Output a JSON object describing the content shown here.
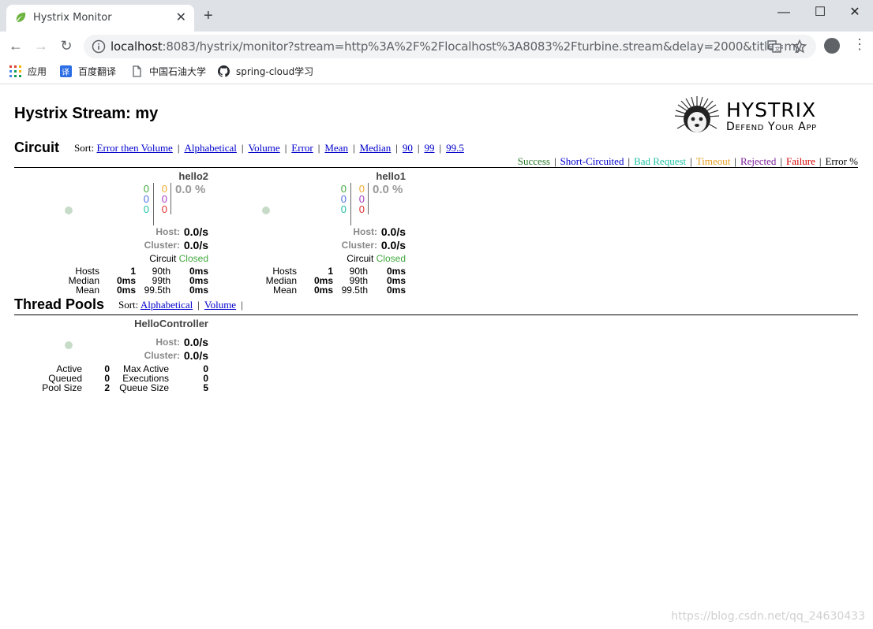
{
  "browser": {
    "tab_title": "Hystrix Monitor",
    "url_host": "localhost",
    "url_rest": ":8083/hystrix/monitor?stream=http%3A%2F%2Flocalhost%3A8083%2Fturbine.stream&delay=2000&title=my",
    "bookmarks": [
      {
        "label": "应用",
        "icon": "apps-grid-icon"
      },
      {
        "label": "百度翻译",
        "icon": "translate-icon"
      },
      {
        "label": "中国石油大学",
        "icon": "page-icon"
      },
      {
        "label": "spring-cloud学习",
        "icon": "github-icon"
      }
    ]
  },
  "page": {
    "title": "Hystrix Stream: my",
    "logo": {
      "line1": "Hystrix",
      "line2": "Defend Your App"
    },
    "circuit": {
      "heading": "Circuit",
      "sort_label": "Sort:",
      "sort_options": [
        "Error then Volume",
        "Alphabetical",
        "Volume",
        "Error",
        "Mean",
        "Median",
        "90",
        "99",
        "99.5"
      ],
      "legend": [
        {
          "label": "Success",
          "color": "#287a28"
        },
        {
          "label": "Short-Circuited",
          "color": "#0000cc"
        },
        {
          "label": "Bad Request",
          "color": "#20c4a4"
        },
        {
          "label": "Timeout",
          "color": "#e6a024"
        },
        {
          "label": "Rejected",
          "color": "#7c1e9a"
        },
        {
          "label": "Failure",
          "color": "#d40000"
        },
        {
          "label": "Error %",
          "color": "#000000"
        }
      ],
      "monitors": [
        {
          "name": "hello2",
          "counts_left": [
            "0",
            "0",
            "0"
          ],
          "counts_right": [
            "0",
            "0",
            "0"
          ],
          "error_pct": "0.0 %",
          "host_label": "Host:",
          "host_rate": "0.0/s",
          "cluster_label": "Cluster:",
          "cluster_rate": "0.0/s",
          "circuit_label": "Circuit",
          "circuit_status": "Closed",
          "stats": {
            "hosts_label": "Hosts",
            "hosts": "1",
            "p90_label": "90th",
            "p90": "0ms",
            "median_label": "Median",
            "median": "0ms",
            "p99_label": "99th",
            "p99": "0ms",
            "mean_label": "Mean",
            "mean": "0ms",
            "p995_label": "99.5th",
            "p995": "0ms"
          }
        },
        {
          "name": "hello1",
          "counts_left": [
            "0",
            "0",
            "0"
          ],
          "counts_right": [
            "0",
            "0",
            "0"
          ],
          "error_pct": "0.0 %",
          "host_label": "Host:",
          "host_rate": "0.0/s",
          "cluster_label": "Cluster:",
          "cluster_rate": "0.0/s",
          "circuit_label": "Circuit",
          "circuit_status": "Closed",
          "stats": {
            "hosts_label": "Hosts",
            "hosts": "1",
            "p90_label": "90th",
            "p90": "0ms",
            "median_label": "Median",
            "median": "0ms",
            "p99_label": "99th",
            "p99": "0ms",
            "mean_label": "Mean",
            "mean": "0ms",
            "p995_label": "99.5th",
            "p995": "0ms"
          }
        }
      ]
    },
    "thread_pools": {
      "heading": "Thread Pools",
      "sort_label": "Sort:",
      "sort_options": [
        "Alphabetical",
        "Volume"
      ],
      "pools": [
        {
          "name": "HelloController",
          "host_label": "Host:",
          "host_rate": "0.0/s",
          "cluster_label": "Cluster:",
          "cluster_rate": "0.0/s",
          "stats": {
            "active_label": "Active",
            "active": "0",
            "max_active_label": "Max Active",
            "max_active": "0",
            "queued_label": "Queued",
            "queued": "0",
            "executions_label": "Executions",
            "executions": "0",
            "pool_size_label": "Pool Size",
            "pool_size": "2",
            "queue_size_label": "Queue Size",
            "queue_size": "5"
          }
        }
      ]
    },
    "watermark": "https://blog.csdn.net/qq_24630433"
  },
  "colors": {
    "count_green": "#41a83e",
    "count_blue": "#4e6ee8",
    "count_teal": "#20c4a4",
    "count_orange": "#f0a830",
    "count_purple": "#a040c0",
    "count_red": "#e03030"
  }
}
